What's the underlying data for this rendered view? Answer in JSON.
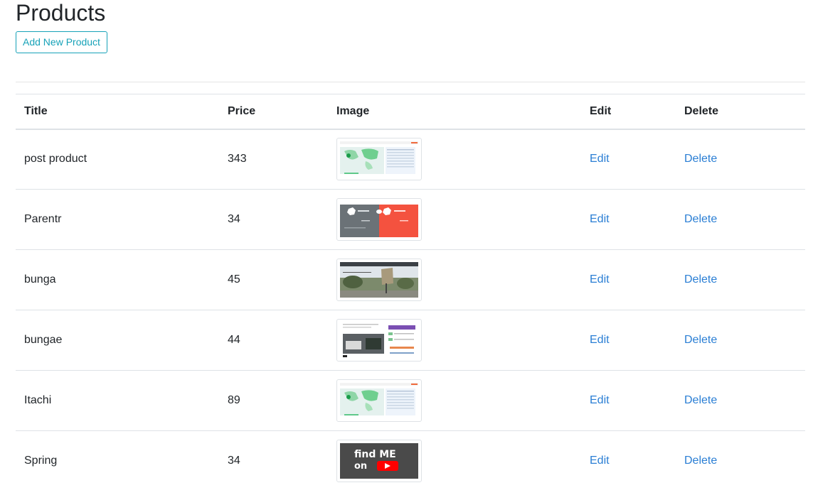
{
  "page": {
    "title": "Products",
    "add_button_label": "Add New Product"
  },
  "table": {
    "headers": {
      "title": "Title",
      "price": "Price",
      "image": "Image",
      "edit": "Edit",
      "delete": "Delete"
    },
    "rows": [
      {
        "title": "post product",
        "price": "343",
        "image": "map-dashboard-screenshot",
        "edit": "Edit",
        "delete": "Delete"
      },
      {
        "title": "Parentr",
        "price": "34",
        "image": "gray-orange-split-screenshot",
        "edit": "Edit",
        "delete": "Delete"
      },
      {
        "title": "bunga",
        "price": "45",
        "image": "street-photo-with-sign",
        "edit": "Edit",
        "delete": "Delete"
      },
      {
        "title": "bungae",
        "price": "44",
        "image": "webpage-with-photo-screenshot",
        "edit": "Edit",
        "delete": "Delete"
      },
      {
        "title": "Itachi",
        "price": "89",
        "image": "map-dashboard-screenshot",
        "edit": "Edit",
        "delete": "Delete"
      },
      {
        "title": "Spring",
        "price": "34",
        "image": "find-me-on-youtube-banner",
        "edit": "Edit",
        "delete": "Delete",
        "image_text": [
          "find ME",
          "on"
        ]
      }
    ]
  }
}
